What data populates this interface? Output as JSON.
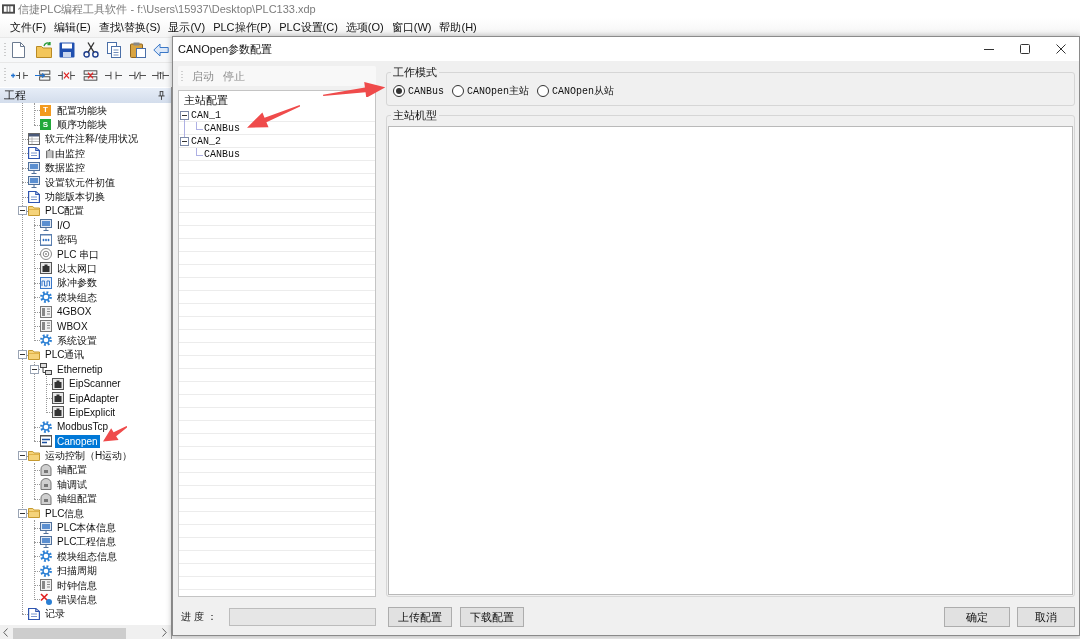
{
  "app_window": {
    "title": "信捷PLC编程工具软件 - f:\\Users\\15937\\Desktop\\PLC133.xdp"
  },
  "menu": [
    "文件(F)",
    "编辑(E)",
    "查找\\替换(S)",
    "显示(V)",
    "PLC操作(P)",
    "PLC设置(C)",
    "选项(O)",
    "窗口(W)",
    "帮助(H)"
  ],
  "project_panel": {
    "title": "工程",
    "tree": [
      {
        "children": [
          {
            "label": "配置功能块",
            "kind": "block",
            "badge": "T",
            "color": "#f39a1e",
            "selected": false
          },
          {
            "label": "顺序功能块",
            "kind": "block",
            "badge": "S",
            "color": "#22a83a",
            "selected": false
          }
        ]
      },
      {
        "label": "软元件注释/使用状况",
        "kind": "table",
        "selected": false
      },
      {
        "label": "自由监控",
        "kind": "page",
        "selected": false
      },
      {
        "label": "数据监控",
        "kind": "monitor",
        "selected": false
      },
      {
        "label": "设置软元件初值",
        "kind": "monitor",
        "selected": false
      },
      {
        "label": "功能版本切换",
        "kind": "page",
        "selected": false
      },
      {
        "label": "PLC配置",
        "kind": "folder",
        "expanded": true,
        "selected": false,
        "children": [
          {
            "label": "I/O",
            "kind": "monitor",
            "selected": false
          },
          {
            "label": "密码",
            "kind": "password",
            "selected": false
          },
          {
            "label": "PLC 串口",
            "kind": "serial",
            "selected": false
          },
          {
            "label": "以太网口",
            "kind": "ethernet",
            "selected": false
          },
          {
            "label": "脉冲参数",
            "kind": "pulse",
            "selected": false
          },
          {
            "label": "模块组态",
            "kind": "gear",
            "selected": false
          },
          {
            "label": "4GBOX",
            "kind": "device",
            "selected": false
          },
          {
            "label": "WBOX",
            "kind": "device",
            "selected": false
          },
          {
            "label": "系统设置",
            "kind": "gear",
            "selected": false
          }
        ]
      },
      {
        "label": "PLC通讯",
        "kind": "folder",
        "expanded": true,
        "selected": false,
        "children": [
          {
            "label": "Ethernetip",
            "kind": "network",
            "expanded": true,
            "selected": false,
            "children": [
              {
                "label": "EipScanner",
                "kind": "ethernet",
                "selected": false
              },
              {
                "label": "EipAdapter",
                "kind": "ethernet",
                "selected": false
              },
              {
                "label": "EipExplicit",
                "kind": "ethernet",
                "selected": false
              }
            ]
          },
          {
            "label": "ModbusTcp",
            "kind": "gear",
            "selected": false
          },
          {
            "label": "Canopen",
            "kind": "card",
            "selected": true
          }
        ]
      },
      {
        "label": "运动控制（H运动）",
        "kind": "folder",
        "expanded": true,
        "selected": false,
        "children": [
          {
            "label": "轴配置",
            "kind": "motor",
            "selected": false
          },
          {
            "label": "轴调试",
            "kind": "motor",
            "selected": false
          },
          {
            "label": "轴组配置",
            "kind": "motor",
            "selected": false
          }
        ]
      },
      {
        "label": "PLC信息",
        "kind": "folder",
        "expanded": true,
        "selected": false,
        "children": [
          {
            "label": "PLC本体信息",
            "kind": "monitor",
            "selected": false
          },
          {
            "label": "PLC工程信息",
            "kind": "monitor",
            "selected": false
          },
          {
            "label": "模块组态信息",
            "kind": "gear",
            "selected": false
          },
          {
            "label": "扫描周期",
            "kind": "gear",
            "selected": false
          },
          {
            "label": "时钟信息",
            "kind": "device",
            "selected": false
          },
          {
            "label": "错误信息",
            "kind": "error",
            "selected": false
          }
        ]
      },
      {
        "label": "记录",
        "kind": "page",
        "selected": false
      }
    ]
  },
  "dialog": {
    "title": "CANOpen参数配置",
    "toolbar": [
      {
        "label": "启动",
        "disabled": true
      },
      {
        "label": "停止",
        "disabled": true
      }
    ],
    "config_tree": {
      "title": "主站配置",
      "items": [
        {
          "label": "CAN_1",
          "expanded": true,
          "children": [
            {
              "label": "CANBus"
            }
          ]
        },
        {
          "label": "CAN_2",
          "expanded": true,
          "children": [
            {
              "label": "CANBus"
            }
          ]
        }
      ]
    },
    "work_mode": {
      "title": "工作模式",
      "options": [
        {
          "label": "CANBus",
          "selected": true
        },
        {
          "label": "CANOpen主站",
          "selected": false
        },
        {
          "label": "CANOpen从站",
          "selected": false
        }
      ]
    },
    "master_model": {
      "title": "主站机型"
    },
    "progress": {
      "label": "进 度 ：",
      "level": 0
    },
    "actions": [
      "上传配置",
      "下载配置"
    ],
    "buttons": [
      "确定",
      "取消"
    ]
  }
}
